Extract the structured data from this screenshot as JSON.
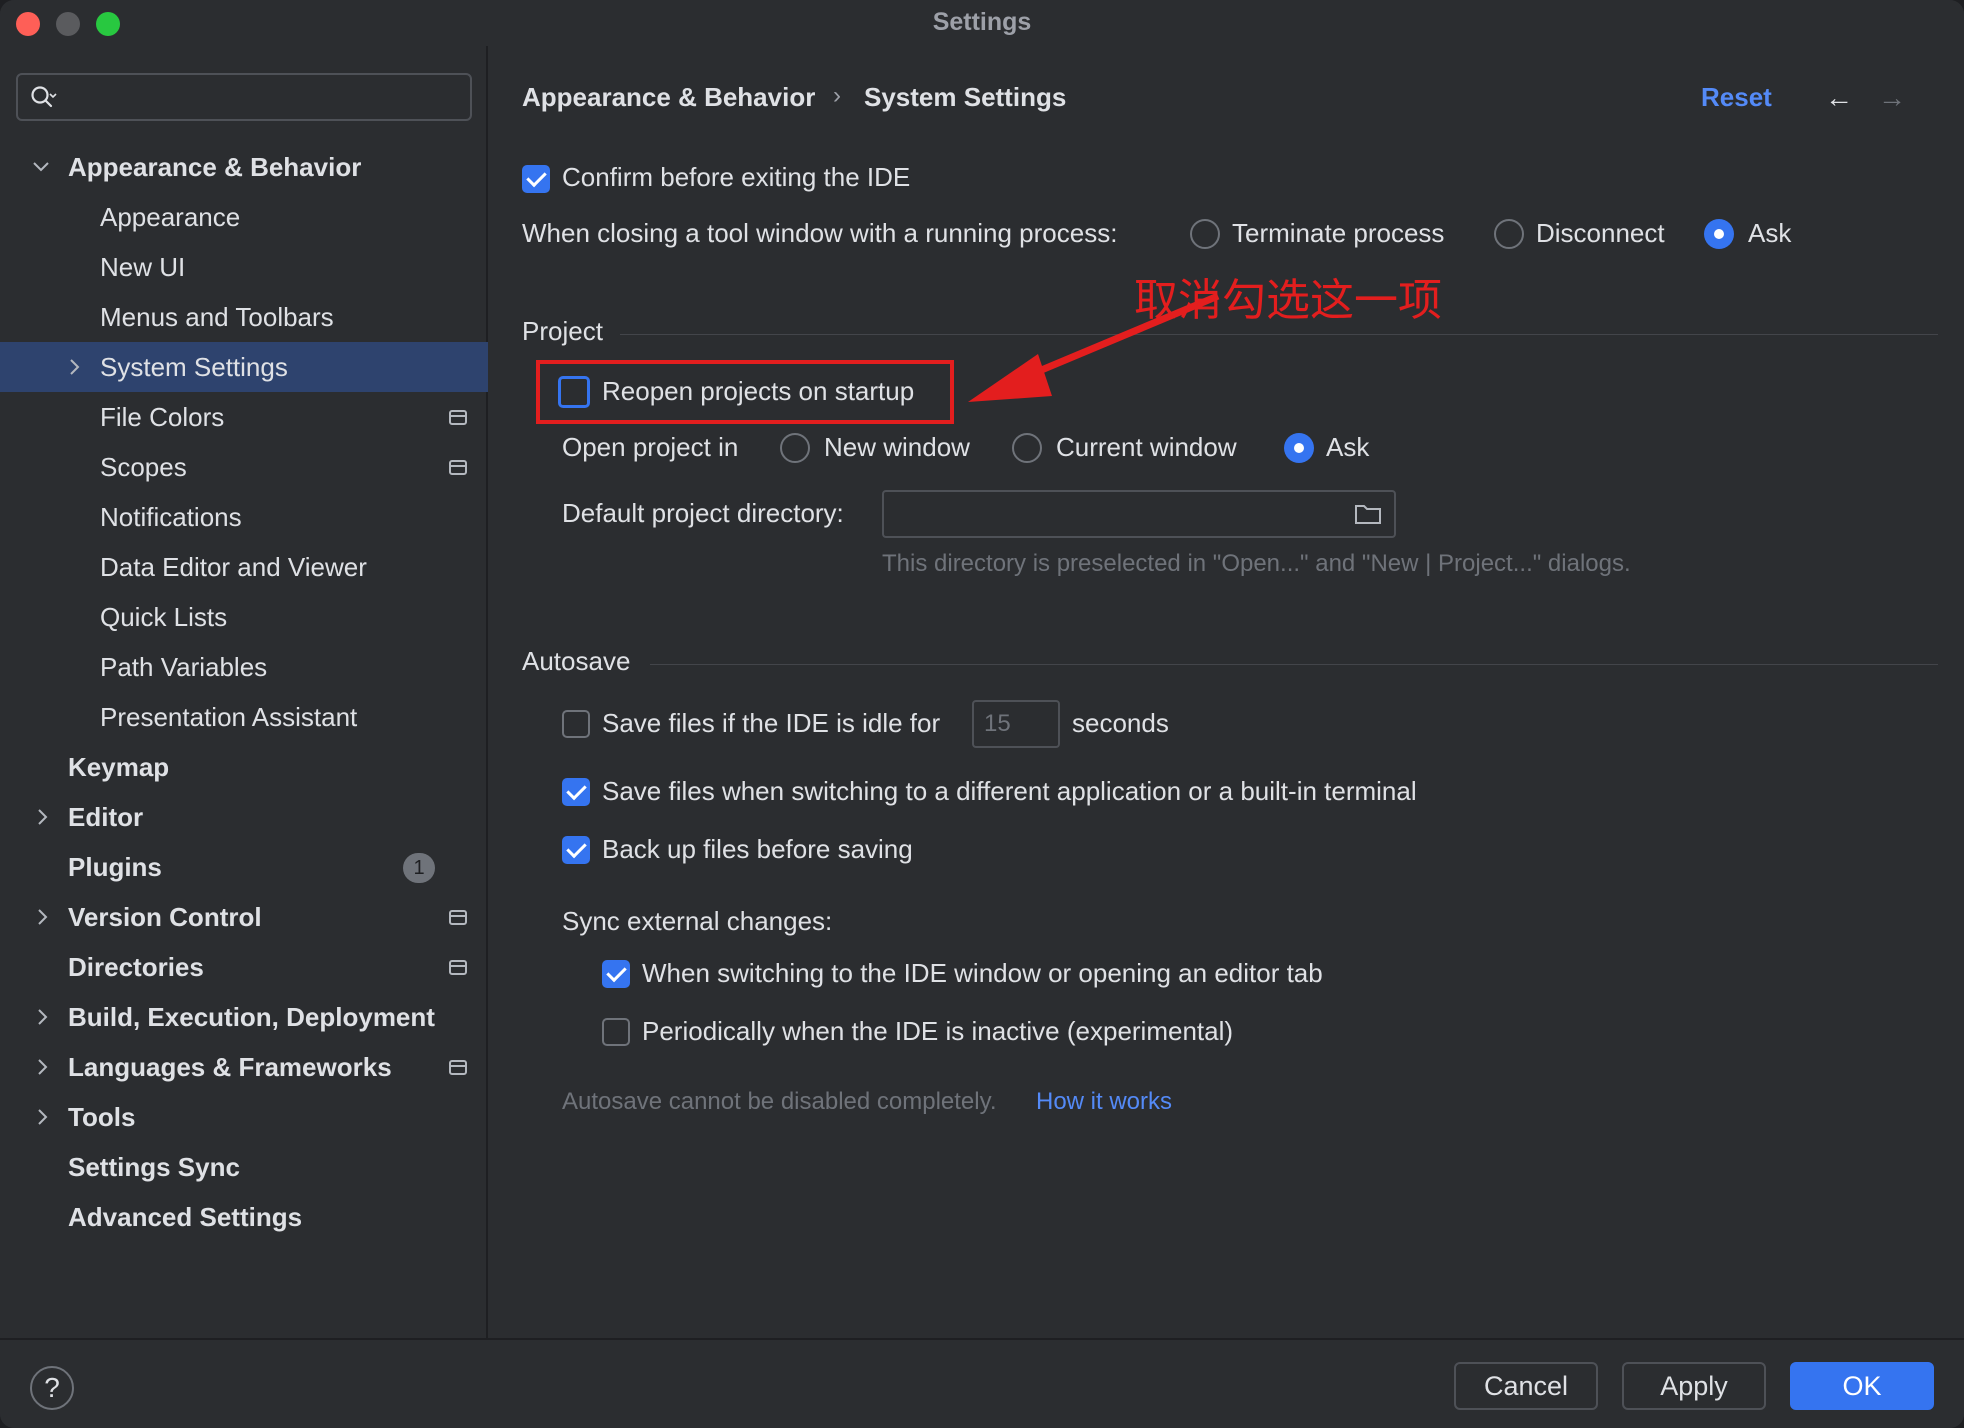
{
  "window": {
    "title": "Settings"
  },
  "sidebar": {
    "search_placeholder": "",
    "items": [
      {
        "label": "Appearance & Behavior"
      },
      {
        "label": "Appearance"
      },
      {
        "label": "New UI"
      },
      {
        "label": "Menus and Toolbars"
      },
      {
        "label": "System Settings"
      },
      {
        "label": "File Colors"
      },
      {
        "label": "Scopes"
      },
      {
        "label": "Notifications"
      },
      {
        "label": "Data Editor and Viewer"
      },
      {
        "label": "Quick Lists"
      },
      {
        "label": "Path Variables"
      },
      {
        "label": "Presentation Assistant"
      },
      {
        "label": "Keymap"
      },
      {
        "label": "Editor"
      },
      {
        "label": "Plugins",
        "badge": "1"
      },
      {
        "label": "Version Control"
      },
      {
        "label": "Directories"
      },
      {
        "label": "Build, Execution, Deployment"
      },
      {
        "label": "Languages & Frameworks"
      },
      {
        "label": "Tools"
      },
      {
        "label": "Settings Sync"
      },
      {
        "label": "Advanced Settings"
      }
    ]
  },
  "header": {
    "breadcrumb_parent": "Appearance & Behavior",
    "breadcrumb_sep": "›",
    "breadcrumb_current": "System Settings",
    "reset": "Reset",
    "back_arrow": "←",
    "forward_arrow": "→"
  },
  "general": {
    "confirm_exit": "Confirm before exiting the IDE",
    "closing_label": "When closing a tool window with a running process:",
    "closing_options": [
      "Terminate process",
      "Disconnect",
      "Ask"
    ]
  },
  "project": {
    "title": "Project",
    "reopen": "Reopen projects on startup",
    "open_in_label": "Open project in",
    "open_in_options": [
      "New window",
      "Current window",
      "Ask"
    ],
    "dir_label": "Default project directory:",
    "dir_value": "",
    "dir_hint": "This directory is preselected in \"Open...\" and \"New | Project...\" dialogs."
  },
  "autosave": {
    "title": "Autosave",
    "idle_prefix": "Save files if the IDE is idle for",
    "idle_value": "15",
    "idle_suffix": "seconds",
    "switching": "Save files when switching to a different application or a built-in terminal",
    "backup": "Back up files before saving",
    "sync_label": "Sync external changes:",
    "sync_window": "When switching to the IDE window or opening an editor tab",
    "sync_periodic": "Periodically when the IDE is inactive (experimental)",
    "note": "Autosave cannot be disabled completely.",
    "note_link": "How it works"
  },
  "annotation": {
    "text": "取消勾选这一项",
    "color": "#e31e1e"
  },
  "footer": {
    "help": "?",
    "cancel": "Cancel",
    "apply": "Apply",
    "ok": "OK"
  },
  "colors": {
    "accent": "#3574f0",
    "link": "#548af7",
    "selection": "#2e436e",
    "background": "#2b2d30"
  }
}
